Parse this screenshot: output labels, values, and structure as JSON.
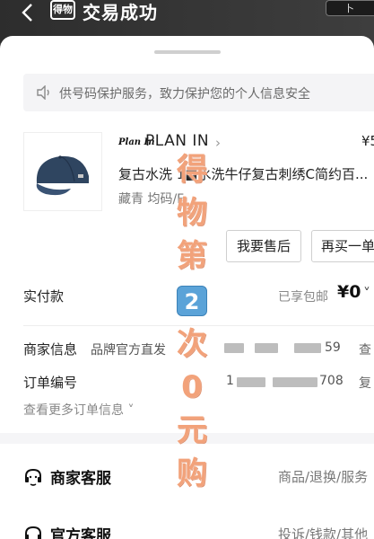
{
  "header": {
    "app_logo_text": "得物",
    "title": "交易成功",
    "top_right_badge": "卜"
  },
  "notice": {
    "text": "供号码保护服务，致力保护您的个人信息安全"
  },
  "product": {
    "brand_logo_text": "Plan In",
    "brand_name": "PLAN IN",
    "brand_chevron": "›",
    "price_partial": "¥5",
    "title": "复古水洗 1■水洗牛仔复古刺绣C简约百...",
    "sku": "藏青 均码/F"
  },
  "actions": {
    "after_sale": "我要售后",
    "rebuy": "再买一单"
  },
  "payment": {
    "label": "实付款",
    "note": "已享包邮",
    "amount": "¥0",
    "chevron": "˅"
  },
  "info": {
    "merchant_label": "商家信息",
    "merchant_value": "品牌官方直发",
    "merchant_masked_tail": "59",
    "merchant_action": "查",
    "order_label": "订单编号",
    "order_masked_head": "1",
    "order_masked_tail": "708",
    "order_action": "复",
    "more_orders": "查看更多订单信息 ˅"
  },
  "services": [
    {
      "title": "商家客服",
      "right": "商品/退换/服务"
    },
    {
      "title": "官方客服",
      "right": "投诉/钱款/其他"
    }
  ],
  "promo": {
    "line1": "得",
    "line2": "物",
    "line3": "第",
    "number": "2",
    "line5": "次",
    "line6": "0",
    "line7": "元",
    "line8": "购"
  }
}
